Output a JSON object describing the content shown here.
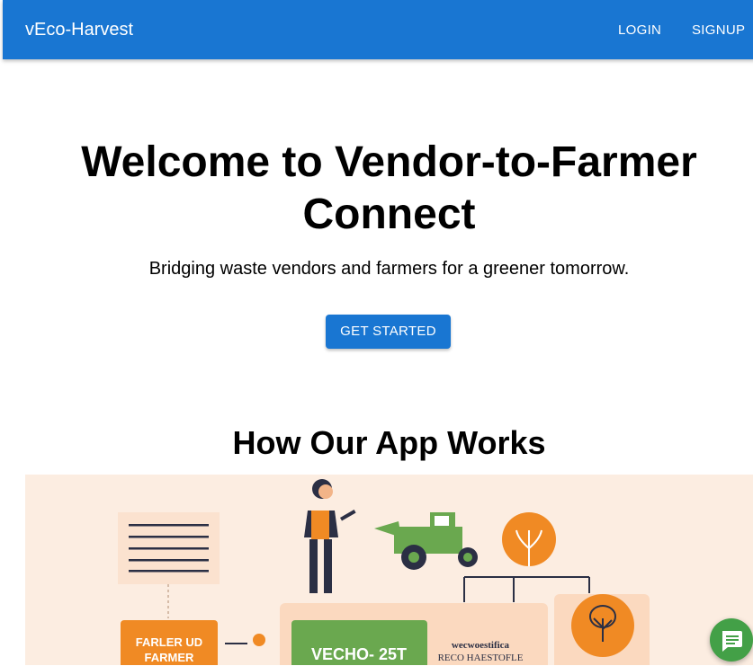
{
  "header": {
    "brand": "vEco-Harvest",
    "login": "LOGIN",
    "signup": "SIGNUP"
  },
  "hero": {
    "title_line1": "Welcome to Vendor-to-Farmer",
    "title_line2": "Connect",
    "subtitle": "Bridging waste vendors and farmers for a greener tomorrow.",
    "cta": "GET STARTED"
  },
  "how": {
    "title": "How Our App Works",
    "illustration": {
      "card_left_line1": "FARLER UD",
      "card_left_line2": "FARMER",
      "card_green": "VECHO- 25T",
      "note_line1": "wecwoestifica",
      "note_line2": "RECO HAESTOFLE"
    }
  },
  "colors": {
    "primary": "#1976d2",
    "chat": "#43a047",
    "orange": "#f08a24",
    "illustration_bg": "#fcede1"
  },
  "icons": {
    "chat": "chat-bubble-icon"
  }
}
